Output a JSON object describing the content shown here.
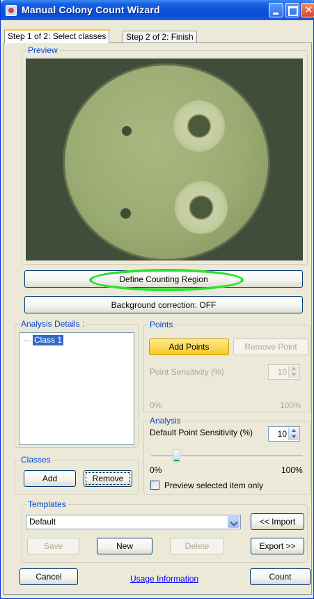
{
  "window": {
    "title": "Manual Colony Count Wizard"
  },
  "tabs": [
    {
      "label": "Step 1 of 2: Select classes",
      "active": true
    },
    {
      "label": "Step 2 of 2: Finish",
      "active": false
    }
  ],
  "preview": {
    "label": "Preview"
  },
  "buttons": {
    "define_region": "Define Counting Region",
    "background_correction": "Background correction: OFF"
  },
  "analysis_details": {
    "label": "Analysis Details :",
    "items": [
      {
        "label": "Class 1",
        "selected": true
      }
    ]
  },
  "classes": {
    "label": "Classes",
    "add": "Add",
    "remove": "Remove"
  },
  "points": {
    "label": "Points",
    "add_points": "Add Points",
    "remove_point": "Remove Point",
    "sensitivity_label": "Point Sensitivity (%)",
    "sensitivity_value": "10",
    "slider_min": "0%",
    "slider_max": "100%"
  },
  "analysis": {
    "label": "Analysis",
    "default_sensitivity_label": "Default Point Sensitivity (%)",
    "default_sensitivity_value": "10",
    "slider_value_fraction": 0.1,
    "slider_min": "0%",
    "slider_max": "100%",
    "preview_checkbox": "Preview selected item only",
    "preview_checked": false
  },
  "templates": {
    "label": "Templates",
    "selected": "Default",
    "import": "<< Import",
    "export": "Export >>",
    "save": "Save",
    "new": "New",
    "delete": "Delete"
  },
  "footer": {
    "cancel": "Cancel",
    "usage_link": "Usage Information",
    "count": "Count"
  },
  "colors": {
    "titlebar": "#0a50d8",
    "accent_highlight": "#2ee02e",
    "group_label": "#0046d5",
    "yellow_button": "#f7c829",
    "selection": "#316ac5"
  }
}
